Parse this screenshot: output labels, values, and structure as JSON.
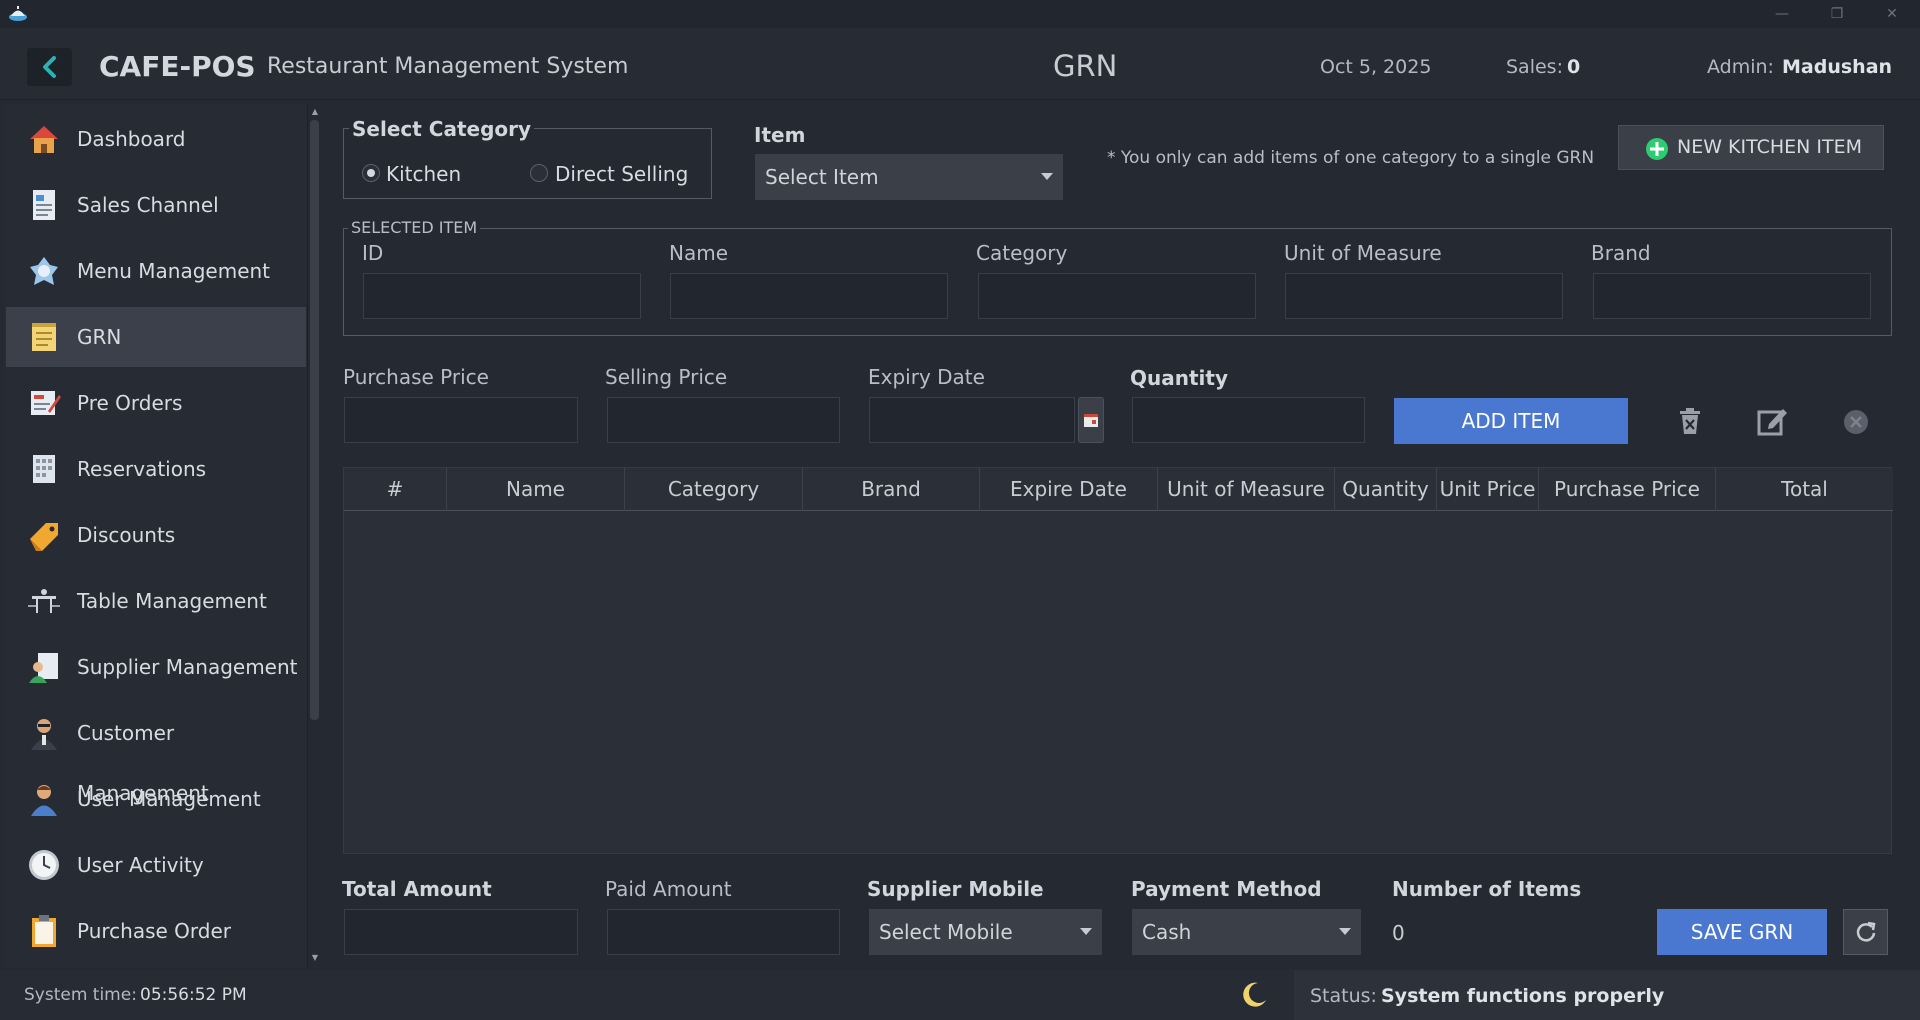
{
  "window": {
    "minimize_glyph": "—",
    "restore_glyph": "❐",
    "close_glyph": "✕"
  },
  "header": {
    "app_name": "CAFE-POS",
    "subtitle": "Restaurant Management System",
    "page_title": "GRN",
    "date": "Oct 5, 2025",
    "sales_label": "Sales:",
    "sales_value": "0",
    "admin_label": "Admin:",
    "admin_name": "Madushan"
  },
  "sidebar": {
    "items": [
      {
        "label": "Dashboard",
        "icon": "house-icon"
      },
      {
        "label": "Sales Channel",
        "icon": "receipt-icon"
      },
      {
        "label": "Menu Management",
        "icon": "menu-icon"
      },
      {
        "label": "GRN",
        "icon": "notepad-icon",
        "active": true
      },
      {
        "label": "Pre Orders",
        "icon": "clipboard-pen-icon"
      },
      {
        "label": "Reservations",
        "icon": "calendar-icon"
      },
      {
        "label": "Discounts",
        "icon": "tag-icon"
      },
      {
        "label": "Table Management",
        "icon": "table-icon"
      },
      {
        "label": "Supplier Management",
        "icon": "supplier-icon"
      },
      {
        "label": "Customer Management",
        "icon": "customer-icon"
      },
      {
        "label": "User Management",
        "icon": "user-icon"
      },
      {
        "label": "User Activity",
        "icon": "clock-icon"
      },
      {
        "label": "Purchase Order",
        "icon": "clipboard-icon"
      }
    ]
  },
  "category": {
    "legend": "Select Category",
    "options": [
      "Kitchen",
      "Direct Selling"
    ],
    "selected": "Kitchen"
  },
  "item_select": {
    "label": "Item",
    "value": "Select Item"
  },
  "note": "* You only can add items of one category to a single GRN",
  "new_item_button": "NEW KITCHEN ITEM",
  "selected_item": {
    "legend": "SELECTED ITEM",
    "fields": {
      "id": "ID",
      "name": "Name",
      "category": "Category",
      "unit": "Unit of Measure",
      "brand": "Brand"
    }
  },
  "entry": {
    "purchase_price": "Purchase Price",
    "selling_price": "Selling Price",
    "expiry_date": "Expiry Date",
    "quantity": "Quantity",
    "add_button": "ADD ITEM"
  },
  "table": {
    "columns": [
      "#",
      "Name",
      "Category",
      "Brand",
      "Expire Date",
      "Unit of Measure",
      "Quantity",
      "Unit Price",
      "Purchase Price",
      "Total"
    ],
    "rows": []
  },
  "footer": {
    "total_amount": "Total Amount",
    "paid_amount": "Paid Amount",
    "supplier_mobile": "Supplier Mobile",
    "supplier_mobile_value": "Select Mobile",
    "payment_method": "Payment Method",
    "payment_method_value": "Cash",
    "number_of_items": "Number of Items",
    "number_of_items_value": "0",
    "save_button": "SAVE GRN"
  },
  "statusbar": {
    "system_time_label": "System time:",
    "system_time": "05:56:52 PM",
    "status_label": "Status:",
    "status_text": "System functions properly"
  },
  "colors": {
    "accent_blue": "#4a78d0",
    "accent_green": "#2ecc71",
    "back_arrow": "#2bb3b3",
    "moon": "#f2d36b"
  }
}
